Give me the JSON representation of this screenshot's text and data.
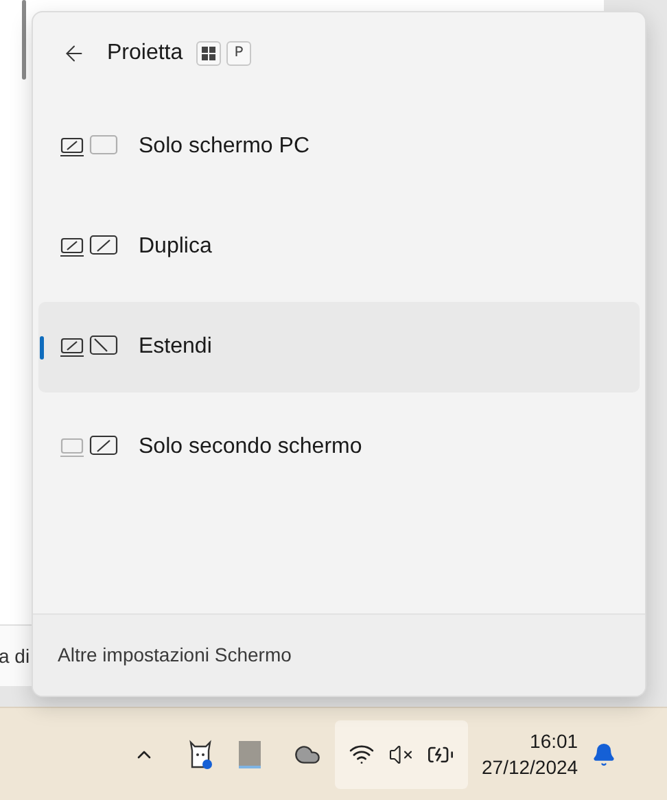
{
  "background_window": {
    "text": "a di"
  },
  "flyout": {
    "title": "Proietta",
    "shortcut_keys": [
      {
        "kind": "windows"
      },
      {
        "kind": "letter",
        "label": "P"
      }
    ],
    "options": [
      {
        "kind": "pc_only",
        "label": "Solo schermo PC",
        "selected": false
      },
      {
        "kind": "duplicate",
        "label": "Duplica",
        "selected": false
      },
      {
        "kind": "extend",
        "label": "Estendi",
        "selected": true
      },
      {
        "kind": "second_only",
        "label": "Solo secondo schermo",
        "selected": false
      }
    ],
    "footer_link": "Altre impostazioni Schermo"
  },
  "taskbar": {
    "time": "16:01",
    "date": "27/12/2024"
  }
}
